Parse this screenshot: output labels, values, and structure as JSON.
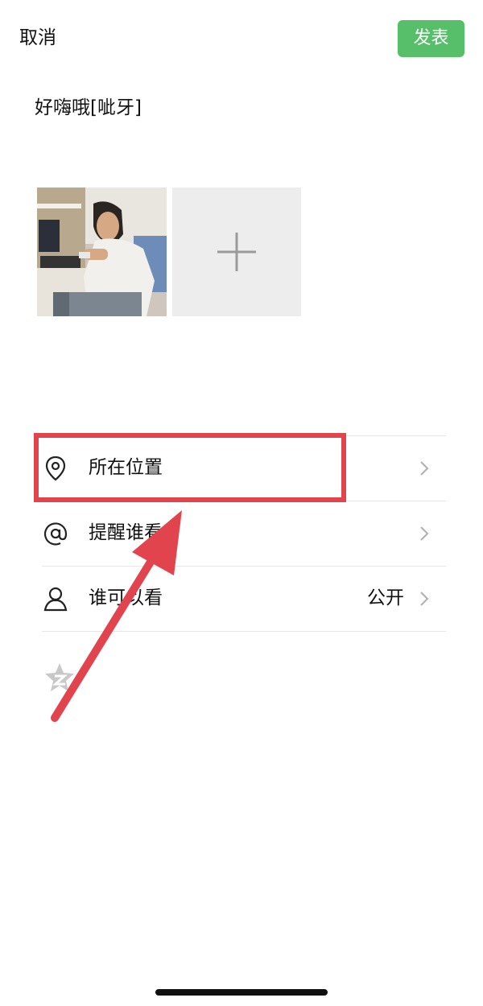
{
  "header": {
    "cancel_label": "取消",
    "publish_label": "发表",
    "publish_color": "#57be6a"
  },
  "post": {
    "text": "好嗨哦[呲牙]"
  },
  "photos": {
    "thumbnail_icon": "photo-thumbnail",
    "add_icon": "plus-icon"
  },
  "options": [
    {
      "icon": "location-pin-icon",
      "label": "所在位置",
      "value": ""
    },
    {
      "icon": "at-sign-icon",
      "label": "提醒谁看",
      "value": ""
    },
    {
      "icon": "person-icon",
      "label": "谁可以看",
      "value": "公开"
    }
  ],
  "qzone": {
    "icon": "qzone-star-icon"
  },
  "annotation": {
    "color": "#e2444e",
    "target": "所在位置"
  }
}
